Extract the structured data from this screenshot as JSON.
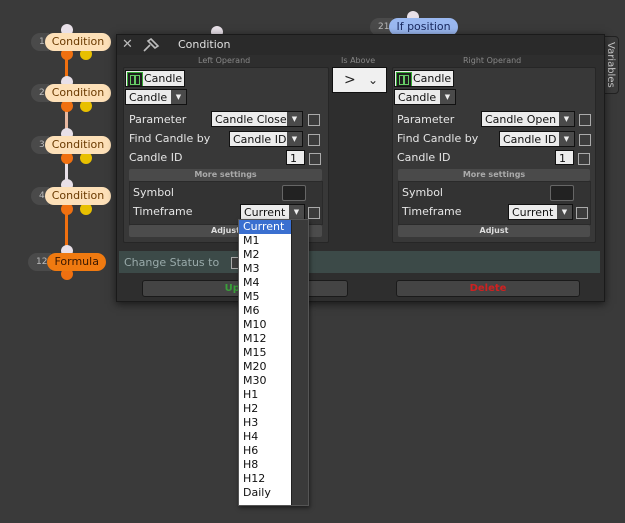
{
  "graph": {
    "nodes": [
      {
        "num": "1",
        "label": "Condition"
      },
      {
        "num": "2",
        "label": "Condition"
      },
      {
        "num": "3",
        "label": "Condition"
      },
      {
        "num": "4",
        "label": "Condition"
      },
      {
        "num": "12",
        "label": "Formula"
      },
      {
        "num": "21",
        "label": "If position"
      }
    ]
  },
  "dialog": {
    "title": "Condition",
    "close_icon": "close-icon",
    "pin_icon": "pin-icon",
    "variables_tab": "Variables",
    "left_caption": "Left Operand",
    "middle_caption": "Is Above",
    "right_caption": "Right Operand",
    "operator": ">",
    "left": {
      "source": "Candle",
      "source_sub": "Candle",
      "parameter_label": "Parameter",
      "parameter_value": "Candle Close",
      "find_label": "Find Candle by",
      "find_value": "Candle ID",
      "id_label": "Candle ID",
      "id_value": "1",
      "more_settings": "More settings",
      "symbol_label": "Symbol",
      "timeframe_label": "Timeframe",
      "timeframe_value": "Current",
      "adjust": "Adjust"
    },
    "right": {
      "source": "Candle",
      "source_sub": "Candle",
      "parameter_label": "Parameter",
      "parameter_value": "Candle Open",
      "find_label": "Find Candle by",
      "find_value": "Candle ID",
      "id_label": "Candle ID",
      "id_value": "1",
      "more_settings": "More settings",
      "symbol_label": "Symbol",
      "timeframe_label": "Timeframe",
      "timeframe_value": "Current",
      "adjust": "Adjust"
    },
    "change_status": "Change Status to",
    "update_button": "Update",
    "delete_button": "Delete",
    "colors": {
      "update": "#3aa03a",
      "delete": "#d02020"
    }
  },
  "dropdown": {
    "selected": "Current",
    "options": [
      "Current",
      "M1",
      "M2",
      "M3",
      "M4",
      "M5",
      "M6",
      "M10",
      "M12",
      "M15",
      "M20",
      "M30",
      "H1",
      "H2",
      "H3",
      "H4",
      "H6",
      "H8",
      "H12",
      "Daily"
    ]
  }
}
